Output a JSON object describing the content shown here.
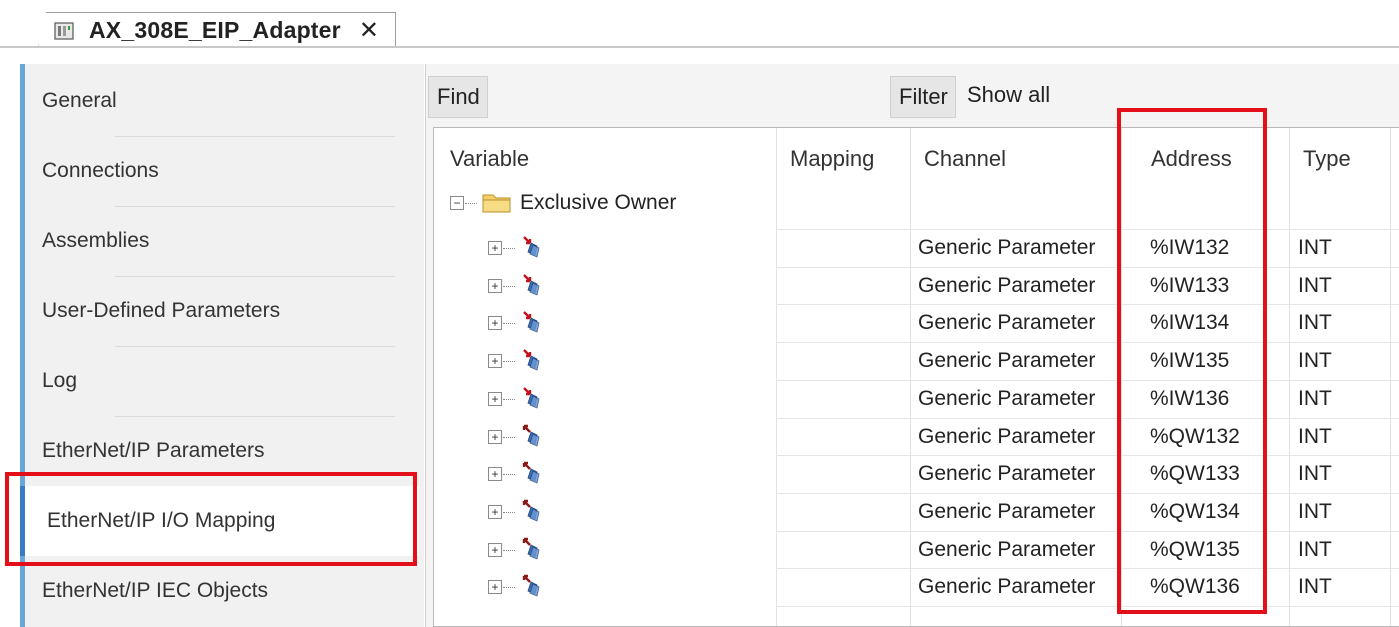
{
  "tab": {
    "title": "AX_308E_EIP_Adapter",
    "close_glyph": "✕",
    "icon": "device-icon"
  },
  "sidebar": {
    "items": [
      {
        "label": "General"
      },
      {
        "label": "Connections"
      },
      {
        "label": "Assemblies"
      },
      {
        "label": "User-Defined Parameters"
      },
      {
        "label": "Log"
      },
      {
        "label": "EtherNet/IP Parameters"
      },
      {
        "label": "EtherNet/IP I/O Mapping",
        "active": true
      },
      {
        "label": "EtherNet/IP IEC Objects"
      }
    ]
  },
  "toolbar": {
    "find_label": "Find",
    "filter_label": "Filter",
    "filter_value": "Show all"
  },
  "table": {
    "headers": {
      "variable": "Variable",
      "mapping": "Mapping",
      "channel": "Channel",
      "address": "Address",
      "type": "Type"
    },
    "group": {
      "label": "Exclusive Owner",
      "icon": "folder-icon"
    },
    "rows": [
      {
        "direction": "input",
        "channel": "Generic Parameter",
        "address": "%IW132",
        "type": "INT"
      },
      {
        "direction": "input",
        "channel": "Generic Parameter",
        "address": "%IW133",
        "type": "INT"
      },
      {
        "direction": "input",
        "channel": "Generic Parameter",
        "address": "%IW134",
        "type": "INT"
      },
      {
        "direction": "input",
        "channel": "Generic Parameter",
        "address": "%IW135",
        "type": "INT"
      },
      {
        "direction": "input",
        "channel": "Generic Parameter",
        "address": "%IW136",
        "type": "INT"
      },
      {
        "direction": "output",
        "channel": "Generic Parameter",
        "address": "%QW132",
        "type": "INT"
      },
      {
        "direction": "output",
        "channel": "Generic Parameter",
        "address": "%QW133",
        "type": "INT"
      },
      {
        "direction": "output",
        "channel": "Generic Parameter",
        "address": "%QW134",
        "type": "INT"
      },
      {
        "direction": "output",
        "channel": "Generic Parameter",
        "address": "%QW135",
        "type": "INT"
      },
      {
        "direction": "output",
        "channel": "Generic Parameter",
        "address": "%QW136",
        "type": "INT"
      }
    ]
  },
  "colors": {
    "highlight": "#e3101a",
    "nav_accent": "#3b7bc4",
    "input_arrow": "#c0141c",
    "output_arrow": "#8b1a1a",
    "param_icon": "#3d6fb3"
  }
}
